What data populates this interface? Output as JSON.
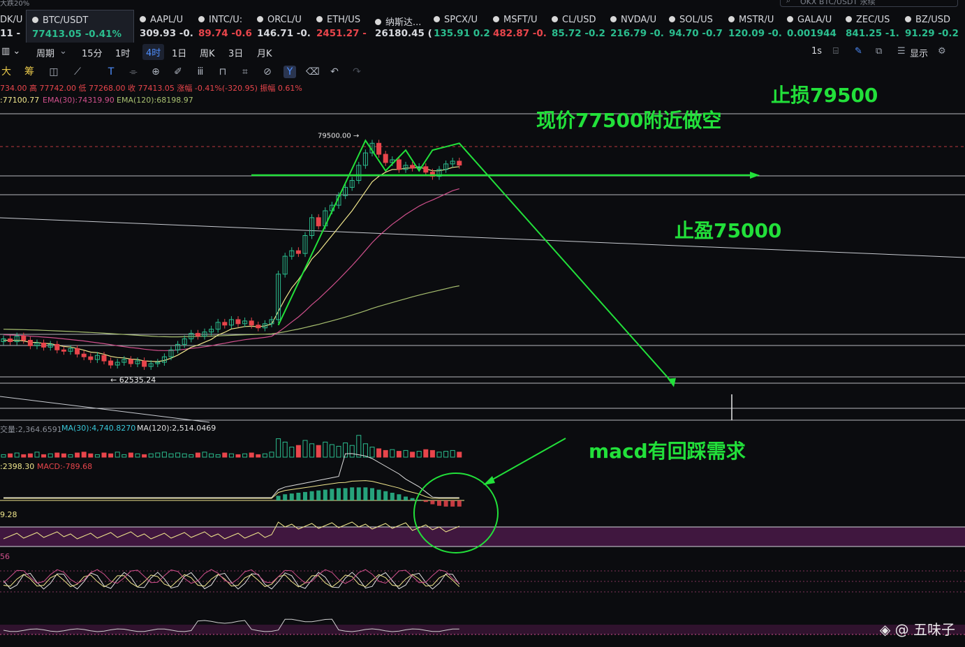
{
  "top": {
    "search_placeholder": "OKX BTC/USDT 永续",
    "corner_label": "大跌20%"
  },
  "tickers": [
    {
      "name": "DK/U",
      "price": "11 -",
      "dir": "neutral",
      "x": 0,
      "w": 30
    },
    {
      "name": "BTC/USDT",
      "price": "77413.05 -0.41%",
      "dir": "up",
      "x": 37,
      "w": 153,
      "active": true
    },
    {
      "name": "AAPL/U",
      "price": "309.93 -0.",
      "dir": "neutral",
      "x": 200,
      "w": 75
    },
    {
      "name": "INTC/U:",
      "price": "89.74 -0.6",
      "dir": "down",
      "x": 284,
      "w": 75
    },
    {
      "name": "ORCL/U",
      "price": "146.71 -0.",
      "dir": "neutral",
      "x": 368,
      "w": 75
    },
    {
      "name": "ETH/US",
      "price": "2451.27 -",
      "dir": "down",
      "x": 453,
      "w": 75
    },
    {
      "name": "纳斯达...",
      "price": "26180.45 (",
      "dir": "neutral",
      "x": 537,
      "w": 75
    },
    {
      "name": "SPCX/U",
      "price": "135.91 0.2",
      "dir": "up",
      "x": 621,
      "w": 75
    },
    {
      "name": "MSFT/U",
      "price": "482.87 -0.",
      "dir": "down",
      "x": 706,
      "w": 75
    },
    {
      "name": "CL/USD",
      "price": "85.72 -0.2",
      "dir": "up",
      "x": 790,
      "w": 75
    },
    {
      "name": "NVDA/U",
      "price": "216.79 -0.",
      "dir": "up",
      "x": 874,
      "w": 75
    },
    {
      "name": "SOL/US",
      "price": "94.70 -0.7",
      "dir": "up",
      "x": 958,
      "w": 75
    },
    {
      "name": "MSTR/U",
      "price": "120.09 -0.",
      "dir": "up",
      "x": 1043,
      "w": 75
    },
    {
      "name": "GALA/U",
      "price": "0.001944",
      "dir": "up",
      "x": 1127,
      "w": 75
    },
    {
      "name": "ZEC/US",
      "price": "841.25 -1.",
      "dir": "up",
      "x": 1211,
      "w": 75
    },
    {
      "name": "BZ/USD",
      "price": "91.29 -0.2",
      "dir": "up",
      "x": 1296,
      "w": 75
    }
  ],
  "intervals": [
    "周期",
    "15分",
    "1时",
    "4时",
    "1日",
    "周K",
    "3日",
    "月K"
  ],
  "selected_interval": "4时",
  "right_controls": {
    "refresh": "1s",
    "display": "显示"
  },
  "toolbar_left": [
    "大",
    "筹"
  ],
  "ohlc_line": "734.00  高 77742.00  低 77268.00  收 77413.05  涨幅 -0.41%(-320.95)  振幅 0.61%",
  "ema_line": {
    "ema_a": ":77100.77",
    "ema30": "EMA(30):74319.90",
    "ema120": "EMA(120):68198.97"
  },
  "volume_line": {
    "vol": "交量:2,364.6591",
    "ma30": "MA(30):4,740.8270",
    "ma120": "MA(120):2,514.0469"
  },
  "macd_line": {
    "dif": ":2398.30",
    "macd": "MACD:-789.68"
  },
  "ind3_label": "9.28",
  "ind4_label": "56",
  "annotations": {
    "stop_loss": "止损79500",
    "entry": "现价77500附近做空",
    "take_profit": "止盈75000",
    "macd_note": "macd有回踩需求",
    "high_label": "79500.00",
    "low_label": "62535.24"
  },
  "colors": {
    "up": "#2bbd8e",
    "down": "#e8454b",
    "annotation": "#22e03a",
    "ema_fast": "#f0e68c",
    "ema30": "#d0508c",
    "ema120": "#a8c070",
    "accent": "#4f8fff"
  },
  "watermark": "@ 五味子",
  "chart_data": {
    "type": "candlestick",
    "interval": "4时",
    "ylim": [
      59000,
      81800
    ],
    "high": 79500.0,
    "low": 62535.24,
    "close": 77413.05,
    "stop_loss": 79500,
    "take_profit": 75000,
    "entry": 77500,
    "closes": [
      64800,
      64600,
      65000,
      64700,
      64300,
      64500,
      64200,
      64400,
      64000,
      63900,
      64100,
      63700,
      63500,
      63300,
      63600,
      63200,
      62900,
      63100,
      63300,
      63000,
      63200,
      62800,
      63000,
      63100,
      63500,
      64000,
      64400,
      64800,
      65200,
      65000,
      65300,
      65500,
      66000,
      65800,
      66200,
      65900,
      66100,
      65800,
      65600,
      65900,
      66200,
      69500,
      70800,
      71200,
      71000,
      72300,
      73600,
      73000,
      74100,
      74500,
      75200,
      75800,
      76300,
      77400,
      78300,
      79000,
      78200,
      77600,
      77800,
      77100,
      77400,
      77200,
      77300,
      76900,
      76600,
      77100,
      77500,
      77700,
      77413
    ],
    "ema_fast": [
      64700,
      64680,
      64700,
      64650,
      64550,
      64540,
      64470,
      64450,
      64350,
      64250,
      64210,
      64100,
      63980,
      63840,
      63800,
      63680,
      63530,
      63450,
      63420,
      63330,
      63300,
      63200,
      63170,
      63150,
      63230,
      63400,
      63620,
      63900,
      64200,
      64350,
      64560,
      64760,
      65080,
      65280,
      65520,
      65600,
      65700,
      65720,
      65680,
      65740,
      65880,
      66800,
      67700,
      68500,
      69100,
      69800,
      70600,
      71100,
      71700,
      72300,
      72900,
      73500,
      74100,
      74800,
      75500,
      76200,
      76600,
      76900,
      77100,
      77100,
      77200,
      77200,
      77250,
      77150,
      77000,
      77000,
      77100,
      77250,
      77300
    ],
    "ema30": [
      65100,
      65080,
      65060,
      65040,
      65000,
      64970,
      64930,
      64900,
      64850,
      64800,
      64750,
      64700,
      64650,
      64580,
      64520,
      64450,
      64380,
      64300,
      64240,
      64170,
      64120,
      64050,
      64000,
      63960,
      63950,
      63960,
      63990,
      64040,
      64110,
      64160,
      64230,
      64300,
      64400,
      64480,
      64580,
      64660,
      64740,
      64800,
      64850,
      64910,
      64990,
      65290,
      65650,
      66030,
      66390,
      66820,
      67290,
      67700,
      68160,
      68620,
      69110,
      69610,
      70120,
      70660,
      71220,
      71790,
      72270,
      72700,
      73120,
      73470,
      73830,
      74140,
      74440,
      74680,
      74880,
      75100,
      75330,
      75560,
      75700
    ],
    "ema120": [
      65500,
      65490,
      65480,
      65470,
      65450,
      65440,
      65420,
      65400,
      65380,
      65360,
      65340,
      65320,
      65290,
      65270,
      65240,
      65210,
      65180,
      65150,
      65120,
      65090,
      65060,
      65030,
      65000,
      64970,
      64960,
      64950,
      64950,
      64960,
      64970,
      64980,
      64990,
      65000,
      65020,
      65040,
      65060,
      65080,
      65100,
      65110,
      65130,
      65140,
      65160,
      65230,
      65320,
      65420,
      65510,
      65620,
      65740,
      65850,
      65980,
      66110,
      66240,
      66380,
      66530,
      66680,
      66840,
      67010,
      67160,
      67300,
      67440,
      67580,
      67710,
      67850,
      67980,
      68100,
      68210,
      68330,
      68440,
      68560,
      68650
    ],
    "volumes": [
      3,
      4,
      5,
      3,
      4,
      6,
      3,
      4,
      5,
      4,
      3,
      5,
      6,
      4,
      3,
      5,
      4,
      6,
      3,
      5,
      4,
      3,
      4,
      5,
      6,
      4,
      5,
      4,
      3,
      5,
      6,
      4,
      3,
      5,
      4,
      3,
      4,
      5,
      3,
      4,
      6,
      22,
      18,
      12,
      14,
      20,
      16,
      14,
      18,
      15,
      13,
      17,
      14,
      26,
      16,
      12,
      10,
      8,
      9,
      7,
      8,
      6,
      7,
      9,
      8,
      6,
      7,
      8,
      6
    ],
    "macd_hist": [
      0,
      0,
      0,
      0,
      0,
      0,
      0,
      0,
      0,
      0,
      0,
      0,
      0,
      0,
      0,
      0,
      0,
      0,
      0,
      0,
      0,
      0,
      0,
      0,
      0,
      0,
      0,
      0,
      0,
      0,
      0,
      0,
      0,
      0,
      0,
      0,
      0,
      0,
      0,
      0,
      0,
      6,
      8,
      9,
      10,
      11,
      12,
      13,
      14,
      15,
      16,
      16,
      17,
      17,
      17,
      16,
      14,
      12,
      10,
      8,
      5,
      3,
      1,
      -2,
      -5,
      -7,
      -8,
      -8,
      -8
    ],
    "zigzag_price": [
      [
        41,
        65800
      ],
      [
        54,
        79200
      ],
      [
        57,
        77000
      ],
      [
        60,
        78500
      ],
      [
        62,
        77000
      ],
      [
        64,
        78500
      ],
      [
        68,
        79000
      ],
      [
        100,
        61500
      ]
    ]
  }
}
